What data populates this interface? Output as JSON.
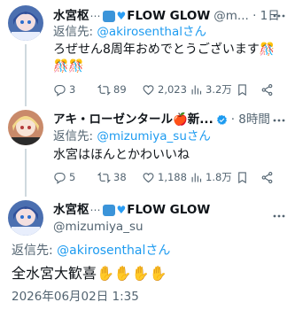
{
  "tweet1": {
    "display_name": "水宮枢",
    "handle_time": "@m... · 1日",
    "flow_glow": "FLOW GLOW",
    "reply_prefix": "返信先: ",
    "reply_handle": "@akirosenthal",
    "reply_suffix": "さん",
    "text": "ろぜせん8周年おめでとうございます🎊🎊🎊",
    "replies": "3",
    "retweets": "89",
    "likes": "2,023",
    "views": "3.2万"
  },
  "tweet2": {
    "display_name": "アキ・ローゼンタール🍎新...",
    "handle_time": "· 8時間",
    "reply_prefix": "返信先: ",
    "reply_handle": "@mizumiya_su",
    "reply_suffix": "さん",
    "text": "水宮はほんとかわいいね",
    "replies": "5",
    "retweets": "38",
    "likes": "1,188",
    "views": "1.8万"
  },
  "tweet3": {
    "display_name": "水宮枢",
    "flow_glow": "FLOW GLOW",
    "handle": "@mizumiya_su",
    "reply_prefix": "返信先: ",
    "reply_handle": "@akirosenthal",
    "reply_suffix": "さん",
    "text": "全水宮大歓喜✋✋✋✋",
    "timestamp": "2026年06月02日 1:35"
  },
  "colors": {
    "link": "#1d9bf0",
    "meta": "#536471",
    "verified": "#1d9bf0"
  },
  "icons": [
    "more-icon",
    "reply-icon",
    "retweet-icon",
    "like-icon",
    "views-icon",
    "bookmark-icon",
    "share-icon"
  ]
}
